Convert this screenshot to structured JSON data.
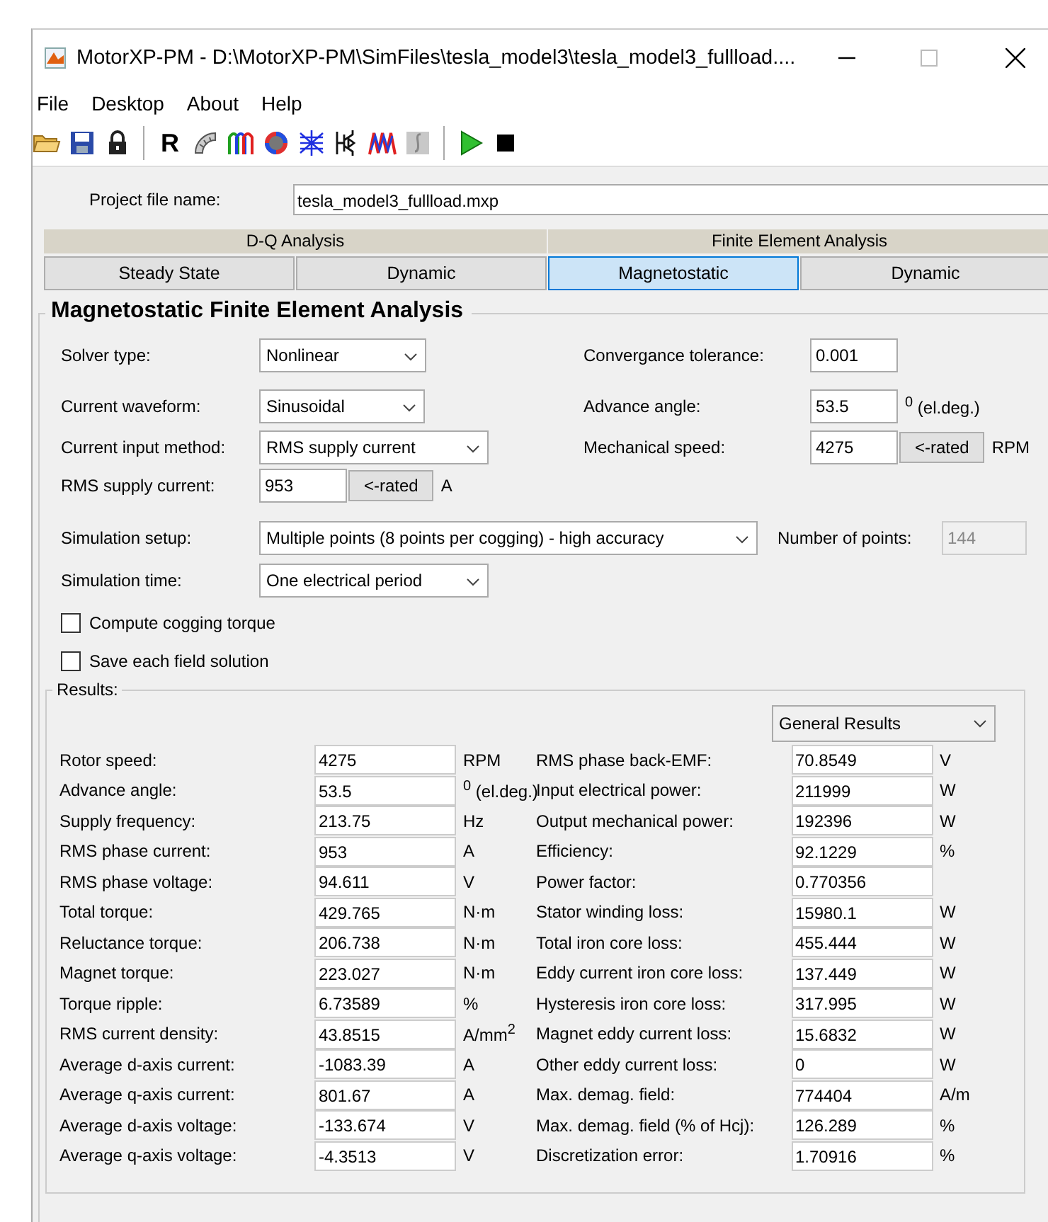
{
  "window": {
    "title": "MotorXP-PM - D:\\MotorXP-PM\\SimFiles\\tesla_model3\\tesla_model3_fullload...."
  },
  "menu": [
    "File",
    "Desktop",
    "About",
    "Help"
  ],
  "toolbar": [
    {
      "kind": "open"
    },
    {
      "kind": "save"
    },
    {
      "kind": "lock"
    },
    {
      "kind": "sep"
    },
    {
      "kind": "letter",
      "label": "R"
    },
    {
      "kind": "stator"
    },
    {
      "kind": "winding"
    },
    {
      "kind": "rotor"
    },
    {
      "kind": "mesh"
    },
    {
      "kind": "circuit"
    },
    {
      "kind": "wave"
    },
    {
      "kind": "disabled"
    },
    {
      "kind": "sep"
    },
    {
      "kind": "play"
    },
    {
      "kind": "stop"
    }
  ],
  "project": {
    "label": "Project file name:",
    "value": "tesla_model3_fullload.mxp"
  },
  "tab_groups": [
    {
      "label": "D-Q Analysis",
      "tabs": [
        {
          "label": "Steady State",
          "selected": false
        },
        {
          "label": "Dynamic",
          "selected": false
        }
      ]
    },
    {
      "label": "Finite Element Analysis",
      "tabs": [
        {
          "label": "Magnetostatic",
          "selected": true
        },
        {
          "label": "Dynamic",
          "selected": false
        }
      ]
    }
  ],
  "panel": {
    "title": "Magnetostatic Finite Element Analysis",
    "left": [
      {
        "label": "Solver type:",
        "kind": "select",
        "value": "Nonlinear"
      },
      {
        "label": "Current waveform:",
        "kind": "select",
        "value": "Sinusoidal"
      },
      {
        "label": "Current input method:",
        "kind": "select",
        "value": "RMS supply current"
      },
      {
        "label": "RMS supply current:",
        "kind": "input",
        "value": "953",
        "button": "<-rated",
        "unit": "A"
      }
    ],
    "right": [
      {
        "label": "Convergance tolerance:",
        "kind": "input",
        "value": "0.001"
      },
      {
        "label": "Advance angle:",
        "kind": "input",
        "value": "53.5",
        "unit": "$^{0}$ (el.deg.)"
      },
      {
        "label": "Mechanical speed:",
        "kind": "input",
        "value": "4275",
        "button": "<-rated",
        "unit": "RPM"
      }
    ],
    "simulation_setup": {
      "label": "Simulation setup:",
      "value": "Multiple points (8 points per cogging) - high accuracy"
    },
    "number_of_points": {
      "label": "Number of points:",
      "value": "144",
      "disabled": true
    },
    "simulation_time": {
      "label": "Simulation time:",
      "value": "One electrical period"
    },
    "checkboxes": [
      {
        "label": "Compute cogging torque",
        "checked": false
      },
      {
        "label": "Save each field solution",
        "checked": false
      }
    ]
  },
  "results": {
    "title": "Results:",
    "view": "General Results",
    "left": [
      {
        "label": "Rotor speed:",
        "value": "4275",
        "unit": "RPM"
      },
      {
        "label": "Advance angle:",
        "value": "53.5",
        "unit": "$^{0}$ (el.deg.)"
      },
      {
        "label": "Supply frequency:",
        "value": "213.75",
        "unit": "Hz"
      },
      {
        "label": "RMS phase current:",
        "value": "953",
        "unit": "A"
      },
      {
        "label": "RMS phase voltage:",
        "value": "94.611",
        "unit": "V"
      },
      {
        "label": "Total torque:",
        "value": "429.765",
        "unit": "N·m"
      },
      {
        "label": "Reluctance torque:",
        "value": "206.738",
        "unit": "N·m"
      },
      {
        "label": "Magnet torque:",
        "value": "223.027",
        "unit": "N·m"
      },
      {
        "label": "Torque ripple:",
        "value": "6.73589",
        "unit": "%"
      },
      {
        "label": "RMS current density:",
        "value": "43.8515",
        "unit": "A/mm$^{2}$"
      },
      {
        "label": "Average d-axis current:",
        "value": "-1083.39",
        "unit": "A"
      },
      {
        "label": "Average q-axis current:",
        "value": "801.67",
        "unit": "A"
      },
      {
        "label": "Average d-axis voltage:",
        "value": "-133.674",
        "unit": "V"
      },
      {
        "label": "Average q-axis voltage:",
        "value": "-4.3513",
        "unit": "V"
      }
    ],
    "right": [
      {
        "label": "RMS phase back-EMF:",
        "value": "70.8549",
        "unit": "V"
      },
      {
        "label": "Input electrical power:",
        "value": "211999",
        "unit": "W"
      },
      {
        "label": "Output mechanical power:",
        "value": "192396",
        "unit": "W"
      },
      {
        "label": "Efficiency:",
        "value": "92.1229",
        "unit": "%"
      },
      {
        "label": "Power factor:",
        "value": "0.770356"
      },
      {
        "label": "Stator winding loss:",
        "value": "15980.1",
        "unit": "W"
      },
      {
        "label": "Total iron core loss:",
        "value": "455.444",
        "unit": "W"
      },
      {
        "label": "Eddy current iron core loss:",
        "value": "137.449",
        "unit": "W"
      },
      {
        "label": "Hysteresis iron core loss:",
        "value": "317.995",
        "unit": "W"
      },
      {
        "label": "Magnet eddy current loss:",
        "value": "15.6832",
        "unit": "W"
      },
      {
        "label": "Other eddy current loss:",
        "value": "0",
        "unit": "W"
      },
      {
        "label": "Max. demag. field:",
        "value": "774404",
        "unit": "A/m"
      },
      {
        "label": "Max. demag. field (% of Hcj):",
        "value": "126.289",
        "unit": "%"
      },
      {
        "label": "Discretization error:",
        "value": "1.70916",
        "unit": "%"
      }
    ]
  }
}
